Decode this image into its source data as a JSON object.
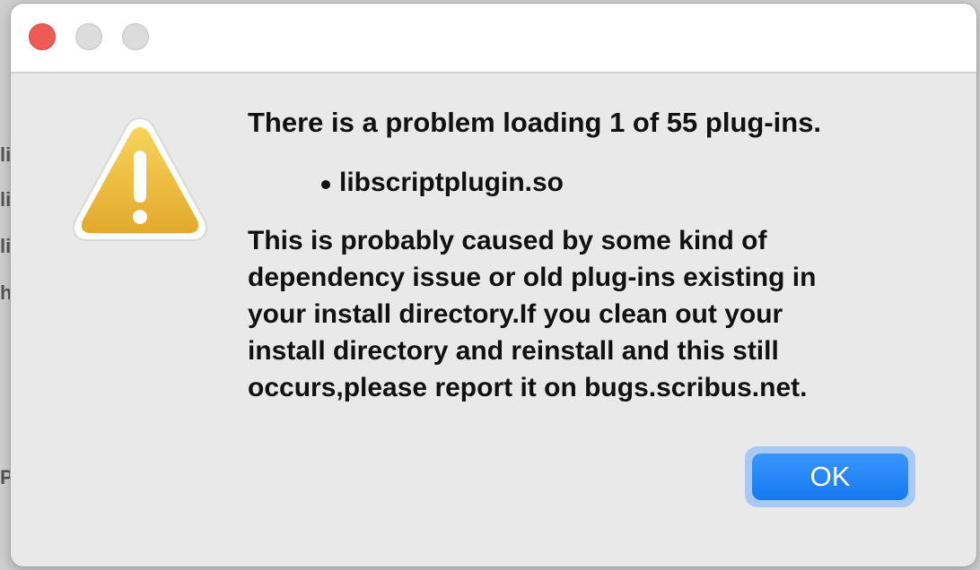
{
  "dialog": {
    "headline": "There is a problem loading 1 of 55 plug-ins.",
    "plugins": [
      "libscriptplugin.so"
    ],
    "body": "This is probably caused by some kind of\ndependency issue or old plug-ins existing in\nyour install directory.If you clean out your\ninstall directory and reinstall and this still\noccurs,please report it on bugs.scribus.net.",
    "ok_label": "OK",
    "icon": "warning-icon"
  },
  "window_controls": [
    "close",
    "minimize",
    "zoom"
  ],
  "colors": {
    "close": "#ee5b54",
    "accent": "#1a7ef3",
    "warning": "#f2c03a"
  }
}
